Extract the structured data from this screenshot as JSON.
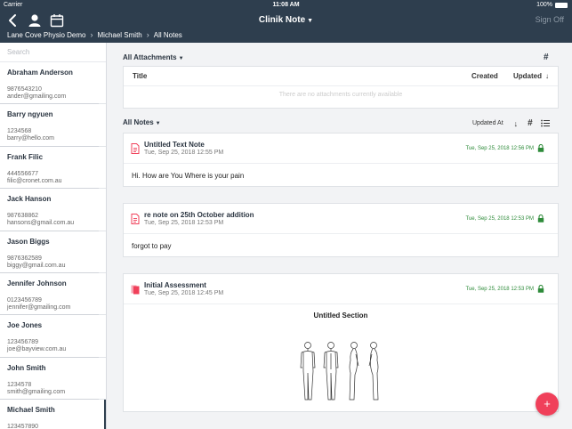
{
  "status": {
    "carrier": "Carrier",
    "time": "11:08 AM",
    "battery": "100%"
  },
  "nav": {
    "title": "Clinik Note",
    "sign_off": "Sign Off",
    "breadcrumb": [
      "Lane Cove Physio Demo",
      "Michael Smith",
      "All Notes"
    ]
  },
  "sidebar": {
    "search_placeholder": "Search",
    "contacts": [
      {
        "name": "Abraham Anderson",
        "phone": "9876543210",
        "email": "ander@gmailing.com"
      },
      {
        "name": "Barry ngyuen",
        "phone": "1234568",
        "email": "barry@hello.com"
      },
      {
        "name": "Frank Filic",
        "phone": "444556677",
        "email": "filic@cronet.com.au"
      },
      {
        "name": "Jack Hanson",
        "phone": "987638862",
        "email": "hansons@gmail.com.au"
      },
      {
        "name": "Jason Biggs",
        "phone": "9876362589",
        "email": "biggy@gmail.com.au"
      },
      {
        "name": "Jennifer Johnson",
        "phone": "0123456789",
        "email": "jennifer@gmailing.com"
      },
      {
        "name": "Joe Jones",
        "phone": "123456789",
        "email": "joe@bayview.com.au"
      },
      {
        "name": "John Smith",
        "phone": "1234578",
        "email": "smith@gmailing.com"
      },
      {
        "name": "Michael Smith",
        "phone": "123457890",
        "email": ""
      }
    ]
  },
  "attachments": {
    "filter": "All Attachments",
    "hash": "#",
    "col_title": "Title",
    "col_created": "Created",
    "col_updated": "Updated",
    "empty": "There are no attachments currently available"
  },
  "notes_toolbar": {
    "filter": "All Notes",
    "sort_label": "Updated At",
    "hash": "#"
  },
  "notes": [
    {
      "title": "Untitled Text Note",
      "date": "Tue, Sep 25, 2018 12:55 PM",
      "updated": "Tue, Sep 25, 2018 12:56 PM",
      "body": "Hi. How are You Where is your pain"
    },
    {
      "title": "re note on 25th October addition",
      "date": "Tue, Sep 25, 2018 12:53 PM",
      "updated": "Tue, Sep 25, 2018 12:53 PM",
      "body": "forgot to pay"
    },
    {
      "title": "Initial Assessment",
      "date": "Tue, Sep 25, 2018 12:45 PM",
      "updated": "Tue, Sep 25, 2018 12:53 PM",
      "section": "Untitled Section"
    }
  ],
  "fab_label": "+",
  "colors": {
    "navbar": "#2e3e4e",
    "accent": "#f0405a",
    "updated_green": "#2e8b3a"
  }
}
